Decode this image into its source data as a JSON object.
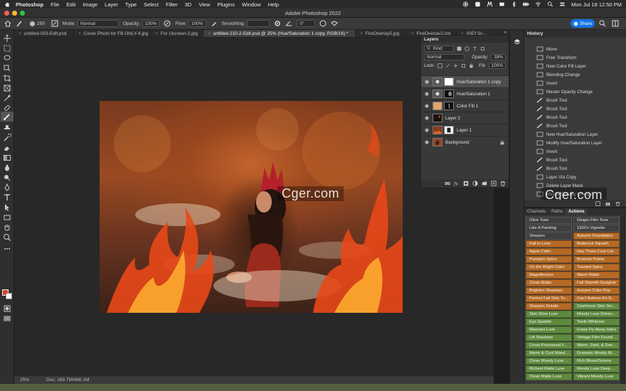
{
  "menubar": {
    "app_name": "Photoshop",
    "items": [
      "File",
      "Edit",
      "Image",
      "Layer",
      "Type",
      "Select",
      "Filter",
      "3D",
      "View",
      "Plugins",
      "Window",
      "Help"
    ],
    "clock": "Mon Jul 18  12:50 PM"
  },
  "window": {
    "title": "Adobe Photoshop 2022"
  },
  "options": {
    "brush_size": "250",
    "mode_label": "Mode:",
    "mode_value": "Normal",
    "opacity_label": "Opacity:",
    "opacity_value": "100%",
    "flow_label": "Flow:",
    "flow_value": "100%",
    "smoothing_label": "Smoothing:",
    "angle_value": "0°",
    "share_label": "Share"
  },
  "tabs": [
    {
      "label": "untitled-553-Edit.psd"
    },
    {
      "label": "Cover Photo for FB ONLY-4.jpg"
    },
    {
      "label": "For Uscreen-2.jpg"
    },
    {
      "label": "untitled-210-2-Edit.psd @ 25% (Hue/Saturation 1 copy, RGB/16) *"
    },
    {
      "label": "FireOverlay5.jpg"
    },
    {
      "label": "FireOverlay2.jpg"
    },
    {
      "label": "00Ef Sc..."
    }
  ],
  "status": {
    "zoom": "25%",
    "doc": "Doc: 169.7M/466.1M"
  },
  "layers_panel": {
    "title": "Layers",
    "kind_filter": "Kind",
    "blend_mode": "Normal",
    "opacity_label": "Opacity:",
    "opacity_value": "18%",
    "lock_label": "Lock:",
    "fill_label": "Fill:",
    "fill_value": "100%",
    "layers": [
      {
        "name": "Hue/Saturation 1 copy"
      },
      {
        "name": "Hue/Saturation 1"
      },
      {
        "name": "Color Fill 1"
      },
      {
        "name": "Layer 2"
      },
      {
        "name": "Layer 1"
      },
      {
        "name": "Background"
      }
    ]
  },
  "history_panel": {
    "title": "History",
    "items": [
      "Move",
      "Free Transform",
      "New Color Fill Layer",
      "Blending Change",
      "Invert",
      "Master Opacity Change",
      "Brush Tool",
      "Brush Tool",
      "Brush Tool",
      "Brush Tool",
      "New Hue/Saturation Layer",
      "Modify Hue/Saturation Layer",
      "Invert",
      "Brush Tool",
      "Brush Tool",
      "Layer Via Copy",
      "Delete Layer Mask",
      "Master Opacity Change"
    ]
  },
  "actions_panel": {
    "tabs": [
      "Channels",
      "Paths",
      "Actions"
    ],
    "left": [
      {
        "label": "Olive Tone",
        "style": "gray"
      },
      {
        "label": "Like A Painting",
        "style": "gray"
      },
      {
        "label": "Sharpen",
        "style": "gray"
      },
      {
        "label": "Fall In Love",
        "style": "orange"
      },
      {
        "label": "Apple Cider",
        "style": "orange"
      },
      {
        "label": "Pumpkin Spice",
        "style": "orange"
      },
      {
        "label": "On the Bright Cider",
        "style": "orange"
      },
      {
        "label": "Magnificence",
        "style": "orange"
      },
      {
        "label": "Clean Matte",
        "style": "orange"
      },
      {
        "label": "Brighten Shadows",
        "style": "orange"
      },
      {
        "label": "Perfect Fall Skin To...",
        "style": "orange"
      },
      {
        "label": "Sharpen Details",
        "style": "orange"
      },
      {
        "label": "Skin Glow Luxe",
        "style": "green"
      },
      {
        "label": "Eye Sparkle",
        "style": "green"
      },
      {
        "label": "Mascara Luxe",
        "style": "green"
      },
      {
        "label": "Lift Shadows",
        "style": "green"
      },
      {
        "label": "Cross Processed F...",
        "style": "green"
      },
      {
        "label": "Warm & Cool Mood...",
        "style": "green"
      },
      {
        "label": "Clean Moody Luxe ...",
        "style": "green"
      },
      {
        "label": "Richest Matte Luxe",
        "style": "green"
      },
      {
        "label": "Clean Matte Luxe",
        "style": "green"
      }
    ],
    "right": [
      {
        "label": "Ginger Film Tone",
        "style": "gray"
      },
      {
        "label": "1920's Vignette",
        "style": "gray"
      },
      {
        "label": "Autumn Foundation",
        "style": "orange"
      },
      {
        "label": "Butternut Squash",
        "style": "orange"
      },
      {
        "label": "Hey There Cool Cat",
        "style": "orange"
      },
      {
        "label": "Brownie Points",
        "style": "orange"
      },
      {
        "label": "Toasted Spice",
        "style": "orange"
      },
      {
        "label": "Warm Matte",
        "style": "orange"
      },
      {
        "label": "Fall Warmth Sunglow",
        "style": "orange"
      },
      {
        "label": "Autumn Color Pop",
        "style": "orange"
      },
      {
        "label": "Can't Believe It's N...",
        "style": "orange"
      },
      {
        "label": "Cashmere Skin Sm...",
        "style": "green"
      },
      {
        "label": "Moody Luxe Dimen...",
        "style": "green"
      },
      {
        "label": "Teeth Whitener",
        "style": "green"
      },
      {
        "label": "Erase Fly Away Hairs",
        "style": "green"
      },
      {
        "label": "Vintage Film Found...",
        "style": "green"
      },
      {
        "label": "Warm, Dark, & Dee...",
        "style": "green"
      },
      {
        "label": "Dramatic Moody Ri...",
        "style": "green"
      },
      {
        "label": "Rich Blues/Greens",
        "style": "green"
      },
      {
        "label": "Moody Luxe Deep ...",
        "style": "green"
      },
      {
        "label": "Vibrant Moody Luxe",
        "style": "green"
      }
    ]
  },
  "watermark": "Cger.com",
  "colors": {
    "accent_blue": "#1473e6",
    "foreground": "#d8452a",
    "background": "#ffffff",
    "action_orange": "#b56a24",
    "action_green": "#5f8a3e"
  }
}
